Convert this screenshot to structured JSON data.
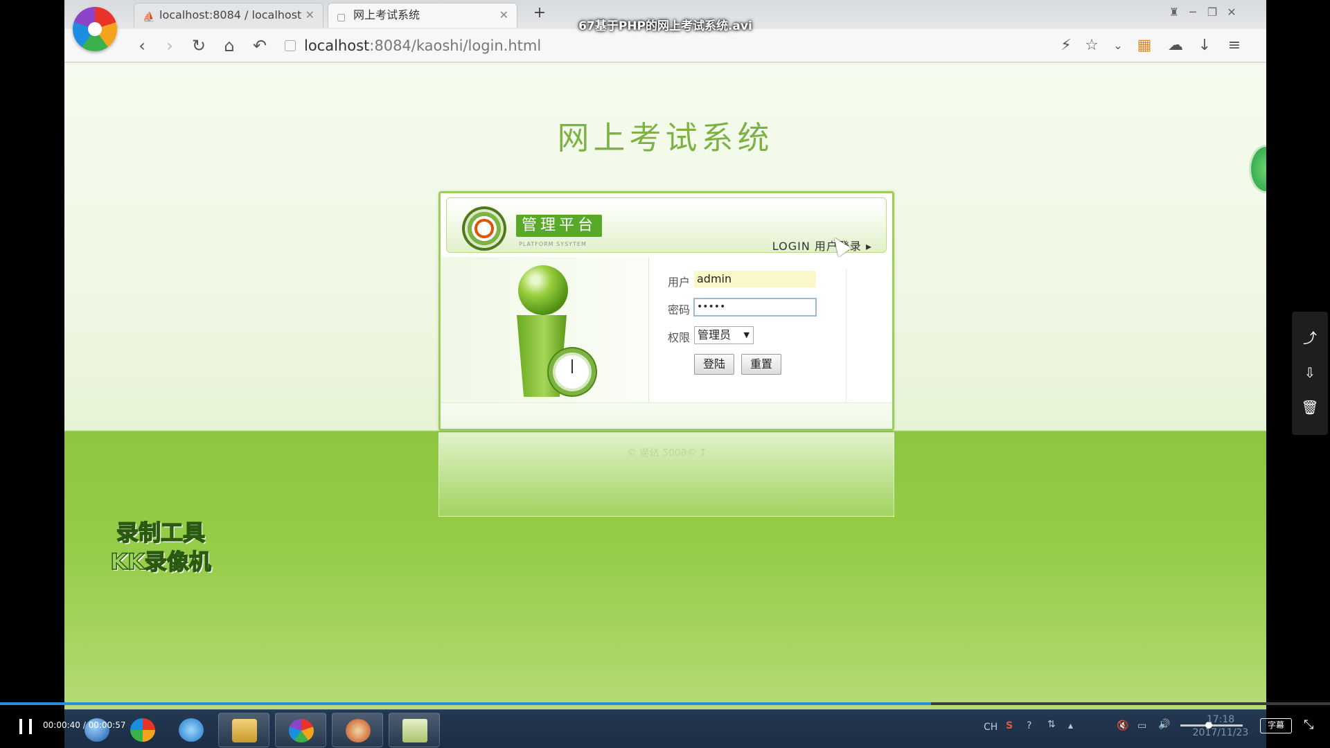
{
  "video_title": "67基于PHP的网上考试系统.avi",
  "browser": {
    "tabs": [
      {
        "label": "localhost:8084 / localhost",
        "active": false,
        "favicon": "pma-icon"
      },
      {
        "label": "网上考试系统",
        "active": true,
        "favicon": "page-icon"
      }
    ],
    "new_tab": "+",
    "url_host": "localhost",
    "url_rest": ":8084/kaoshi/login.html"
  },
  "page": {
    "title": "网上考试系统",
    "panel": {
      "brand": "管理平台",
      "brand_sub": "PLATFORM SYSYTEM",
      "login_caption": "LOGIN 用户登录 ▸",
      "user_label": "用户",
      "user_value": "admin",
      "pass_label": "密码",
      "pass_value": "•••••",
      "role_label": "权限",
      "role_value": "管理员",
      "login_button": "登陆",
      "reset_button": "重置"
    },
    "reflection_text": "© 版权 2009© 1"
  },
  "watermark": {
    "line1": "录制工具",
    "line2": "KK录像机"
  },
  "player": {
    "time": "00:00:40 / 00:00:57",
    "progress": 0.7,
    "subtitle_label": "字幕",
    "clock_time": "17:18",
    "clock_date": "2017/11/23",
    "tray_ime": "CH"
  },
  "colors": {
    "accent": "#7cb342",
    "progress": "#2a8bdc"
  }
}
